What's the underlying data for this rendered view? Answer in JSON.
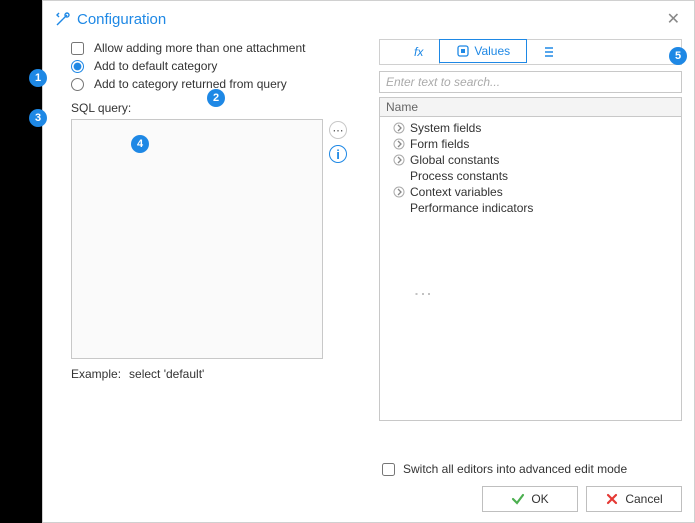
{
  "title": "Configuration",
  "close_label": "✕",
  "left": {
    "allow_attach": "Allow adding more than one attachment",
    "add_default": "Add to default category",
    "add_query": "Add to category returned from query",
    "sql_label": "SQL query:",
    "example_label": "Example:",
    "example_value": "select 'default'"
  },
  "right": {
    "tabs": {
      "fx": "fx",
      "values": "Values",
      "list": ""
    },
    "search_placeholder": "Enter text to search...",
    "col_header": "Name",
    "tree": [
      {
        "label": "System fields",
        "expandable": true
      },
      {
        "label": "Form fields",
        "expandable": true
      },
      {
        "label": "Global constants",
        "expandable": true
      },
      {
        "label": "Process constants",
        "expandable": false
      },
      {
        "label": "Context variables",
        "expandable": true
      },
      {
        "label": "Performance indicators",
        "expandable": false
      }
    ]
  },
  "bottom": {
    "advanced": "Switch all editors into advanced edit mode",
    "ok": "OK",
    "cancel": "Cancel"
  },
  "annotations": {
    "b1": "1",
    "b2": "2",
    "b3": "3",
    "b4": "4",
    "b5": "5"
  }
}
